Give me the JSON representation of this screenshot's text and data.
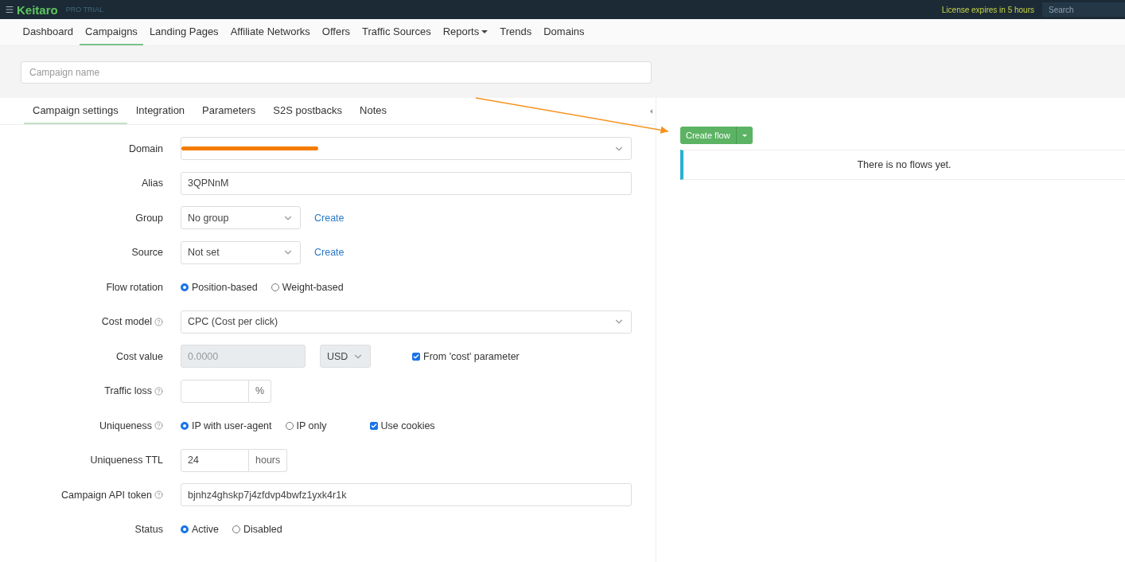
{
  "topbar": {
    "logo": "Keitaro",
    "edition": "PRO TRIAL",
    "license": "License expires in 5 hours",
    "search": {
      "placeholder": "Search"
    }
  },
  "nav": [
    {
      "label": "Dashboard",
      "selected": false,
      "dropdown": false
    },
    {
      "label": "Campaigns",
      "selected": true,
      "dropdown": false
    },
    {
      "label": "Landing Pages",
      "selected": false,
      "dropdown": false
    },
    {
      "label": "Affiliate Networks",
      "selected": false,
      "dropdown": false
    },
    {
      "label": "Offers",
      "selected": false,
      "dropdown": false
    },
    {
      "label": "Traffic Sources",
      "selected": false,
      "dropdown": false
    },
    {
      "label": "Reports",
      "selected": false,
      "dropdown": true
    },
    {
      "label": "Trends",
      "selected": false,
      "dropdown": false
    },
    {
      "label": "Domains",
      "selected": false,
      "dropdown": false
    }
  ],
  "campaign_name": {
    "placeholder": "Campaign name"
  },
  "tabs": [
    {
      "label": "Campaign settings",
      "selected": true
    },
    {
      "label": "Integration",
      "selected": false
    },
    {
      "label": "Parameters",
      "selected": false
    },
    {
      "label": "S2S postbacks",
      "selected": false
    },
    {
      "label": "Notes",
      "selected": false
    }
  ],
  "fields": [
    {
      "label": "Domain",
      "help": false,
      "kind": "select",
      "redacted": true
    },
    {
      "label": "Alias",
      "help": false,
      "kind": "text",
      "value": "3QPNnM"
    },
    {
      "label": "Group",
      "help": false,
      "kind": "select_link",
      "value": "No group",
      "link": "Create"
    },
    {
      "label": "Source",
      "help": false,
      "kind": "select_link",
      "value": "Not set",
      "link": "Create"
    },
    {
      "label": "Flow rotation",
      "help": false,
      "kind": "radios",
      "options": [
        {
          "label": "Position-based",
          "selected": true
        },
        {
          "label": "Weight-based",
          "selected": false
        }
      ]
    },
    {
      "label": "Cost model",
      "help": true,
      "kind": "select",
      "value": "CPC (Cost per click)"
    },
    {
      "label": "Cost value",
      "help": false,
      "kind": "cost",
      "value": "0.0000",
      "disabled": true,
      "currency": "USD",
      "checkbox": {
        "label": "From 'cost' parameter",
        "checked": true
      }
    },
    {
      "label": "Traffic loss",
      "help": true,
      "kind": "addon",
      "addon": "%"
    },
    {
      "label": "Uniqueness",
      "help": true,
      "kind": "radios",
      "options": [
        {
          "label": "IP with user-agent",
          "selected": true
        },
        {
          "label": "IP only",
          "selected": false
        }
      ],
      "checkbox": {
        "label": "Use cookies",
        "checked": true
      }
    },
    {
      "label": "Uniqueness TTL",
      "help": false,
      "kind": "addon",
      "value": "24",
      "addon": "hours"
    },
    {
      "label": "Campaign API token",
      "help": true,
      "kind": "text",
      "value": "bjnhz4ghskp7j4zfdvp4bwfz1yxk4r1k"
    },
    {
      "label": "Status",
      "help": false,
      "kind": "radios",
      "options": [
        {
          "label": "Active",
          "selected": true
        },
        {
          "label": "Disabled",
          "selected": false
        }
      ]
    }
  ],
  "flows": {
    "button": "Create flow",
    "empty": "There is no flows yet."
  }
}
